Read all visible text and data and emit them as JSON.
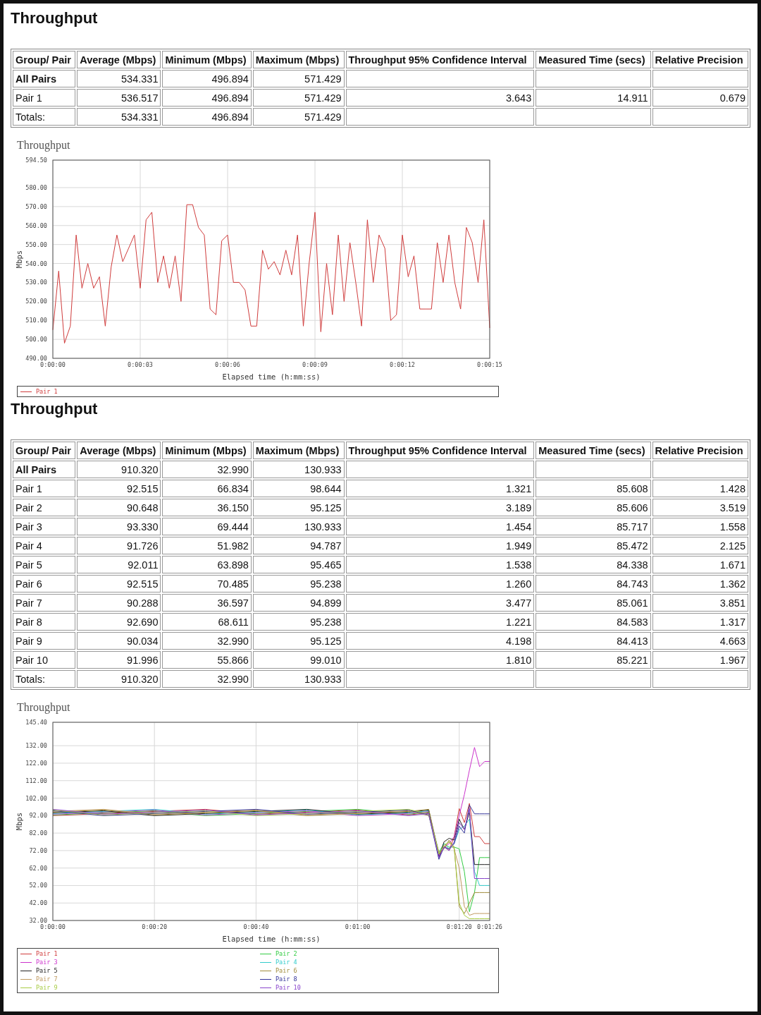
{
  "sections": [
    {
      "heading": "Throughput",
      "table": {
        "columns": [
          "Group/ Pair",
          "Average (Mbps)",
          "Minimum (Mbps)",
          "Maximum (Mbps)",
          "Throughput 95% Confidence Interval",
          "Measured Time (secs)",
          "Relative Precision"
        ],
        "rows": [
          {
            "kind": "group",
            "cells": [
              "All Pairs",
              "534.331",
              "496.894",
              "571.429",
              null,
              null,
              null
            ]
          },
          {
            "kind": "pair",
            "cells": [
              "Pair 1",
              "536.517",
              "496.894",
              "571.429",
              "3.643",
              "14.911",
              "0.679"
            ]
          },
          {
            "kind": "total",
            "cells": [
              "Totals:",
              "534.331",
              "496.894",
              "571.429",
              null,
              null,
              null
            ]
          }
        ]
      },
      "chart": {
        "chart_data": {
          "type": "line",
          "title": "Throughput",
          "xlabel": "Elapsed time (h:mm:ss)",
          "ylabel": "Mbps",
          "grid": true,
          "xlim": [
            0,
            15
          ],
          "ylim": [
            490,
            594.5
          ],
          "xticks": [
            {
              "value": 0,
              "label": "0:00:00"
            },
            {
              "value": 3,
              "label": "0:00:03"
            },
            {
              "value": 6,
              "label": "0:00:06"
            },
            {
              "value": 9,
              "label": "0:00:09"
            },
            {
              "value": 12,
              "label": "0:00:12"
            },
            {
              "value": 15,
              "label": "0:00:15"
            }
          ],
          "yticks": [
            {
              "value": 490,
              "label": "490.00"
            },
            {
              "value": 500,
              "label": "500.00"
            },
            {
              "value": 510,
              "label": "510.00"
            },
            {
              "value": 520,
              "label": "520.00"
            },
            {
              "value": 530,
              "label": "530.00"
            },
            {
              "value": 540,
              "label": "540.00"
            },
            {
              "value": 550,
              "label": "550.00"
            },
            {
              "value": 560,
              "label": "560.00"
            },
            {
              "value": 570,
              "label": "570.00"
            },
            {
              "value": 580,
              "label": "580.00"
            },
            {
              "value": 594.5,
              "label": "594.50"
            }
          ],
          "x": [
            0,
            0.2,
            0.4,
            0.6,
            0.8,
            1,
            1.2,
            1.4,
            1.6,
            1.8,
            2,
            2.2,
            2.4,
            2.6,
            2.8,
            3,
            3.2,
            3.4,
            3.6,
            3.8,
            4,
            4.2,
            4.4,
            4.6,
            4.8,
            5,
            5.2,
            5.4,
            5.6,
            5.8,
            6,
            6.2,
            6.4,
            6.6,
            6.8,
            7,
            7.2,
            7.4,
            7.6,
            7.8,
            8,
            8.2,
            8.4,
            8.6,
            8.8,
            9,
            9.2,
            9.4,
            9.6,
            9.8,
            10,
            10.2,
            10.4,
            10.6,
            10.8,
            11,
            11.2,
            11.4,
            11.6,
            11.8,
            12,
            12.2,
            12.4,
            12.6,
            12.8,
            13,
            13.2,
            13.4,
            13.6,
            13.8,
            14,
            14.2,
            14.4,
            14.6,
            14.8,
            15
          ],
          "series": [
            {
              "name": "Pair 1",
              "color": "#d03c3c",
              "values": [
                505,
                536,
                498,
                507,
                555,
                527,
                540,
                527,
                533,
                507,
                538,
                555,
                541,
                548,
                555,
                527,
                563,
                567,
                530,
                544,
                527,
                544,
                520,
                571,
                571,
                559,
                555,
                516,
                513,
                552,
                555,
                530,
                530,
                526,
                507,
                507,
                547,
                537,
                541,
                534,
                547,
                534,
                555,
                507,
                540,
                567,
                504,
                540,
                513,
                555,
                520,
                551,
                530,
                507,
                563,
                530,
                555,
                548,
                510,
                513,
                555,
                533,
                544,
                516,
                516,
                516,
                551,
                530,
                555,
                530,
                516,
                559,
                551,
                530,
                563,
                506
              ]
            }
          ]
        }
      }
    },
    {
      "heading": "Throughput",
      "table": {
        "columns": [
          "Group/ Pair",
          "Average (Mbps)",
          "Minimum (Mbps)",
          "Maximum (Mbps)",
          "Throughput 95% Confidence Interval",
          "Measured Time (secs)",
          "Relative Precision"
        ],
        "rows": [
          {
            "kind": "group",
            "cells": [
              "All Pairs",
              "910.320",
              "32.990",
              "130.933",
              null,
              null,
              null
            ]
          },
          {
            "kind": "pair",
            "cells": [
              "Pair 1",
              "92.515",
              "66.834",
              "98.644",
              "1.321",
              "85.608",
              "1.428"
            ]
          },
          {
            "kind": "pair",
            "cells": [
              "Pair 2",
              "90.648",
              "36.150",
              "95.125",
              "3.189",
              "85.606",
              "3.519"
            ]
          },
          {
            "kind": "pair",
            "cells": [
              "Pair 3",
              "93.330",
              "69.444",
              "130.933",
              "1.454",
              "85.717",
              "1.558"
            ]
          },
          {
            "kind": "pair",
            "cells": [
              "Pair 4",
              "91.726",
              "51.982",
              "94.787",
              "1.949",
              "85.472",
              "2.125"
            ]
          },
          {
            "kind": "pair",
            "cells": [
              "Pair 5",
              "92.011",
              "63.898",
              "95.465",
              "1.538",
              "84.338",
              "1.671"
            ]
          },
          {
            "kind": "pair",
            "cells": [
              "Pair 6",
              "92.515",
              "70.485",
              "95.238",
              "1.260",
              "84.743",
              "1.362"
            ]
          },
          {
            "kind": "pair",
            "cells": [
              "Pair 7",
              "90.288",
              "36.597",
              "94.899",
              "3.477",
              "85.061",
              "3.851"
            ]
          },
          {
            "kind": "pair",
            "cells": [
              "Pair 8",
              "92.690",
              "68.611",
              "95.238",
              "1.221",
              "84.583",
              "1.317"
            ]
          },
          {
            "kind": "pair",
            "cells": [
              "Pair 9",
              "90.034",
              "32.990",
              "95.125",
              "4.198",
              "84.413",
              "4.663"
            ]
          },
          {
            "kind": "pair",
            "cells": [
              "Pair 10",
              "91.996",
              "55.866",
              "99.010",
              "1.810",
              "85.221",
              "1.967"
            ]
          },
          {
            "kind": "total",
            "cells": [
              "Totals:",
              "910.320",
              "32.990",
              "130.933",
              null,
              null,
              null
            ]
          }
        ]
      },
      "chart": {
        "chart_data": {
          "type": "line",
          "title": "Throughput",
          "xlabel": "Elapsed time (h:mm:ss)",
          "ylabel": "Mbps",
          "grid": true,
          "xlim": [
            0,
            86
          ],
          "ylim": [
            32,
            145.4
          ],
          "xticks": [
            {
              "value": 0,
              "label": "0:00:00"
            },
            {
              "value": 20,
              "label": "0:00:20"
            },
            {
              "value": 40,
              "label": "0:00:40"
            },
            {
              "value": 60,
              "label": "0:01:00"
            },
            {
              "value": 80,
              "label": "0:01:20"
            },
            {
              "value": 86,
              "label": "0:01:26"
            }
          ],
          "yticks": [
            {
              "value": 32,
              "label": "32.00"
            },
            {
              "value": 42,
              "label": "42.00"
            },
            {
              "value": 52,
              "label": "52.00"
            },
            {
              "value": 62,
              "label": "62.00"
            },
            {
              "value": 72,
              "label": "72.00"
            },
            {
              "value": 82,
              "label": "82.00"
            },
            {
              "value": 92,
              "label": "92.00"
            },
            {
              "value": 102,
              "label": "102.00"
            },
            {
              "value": 112,
              "label": "112.00"
            },
            {
              "value": 122,
              "label": "122.00"
            },
            {
              "value": 132,
              "label": "132.00"
            },
            {
              "value": 145.4,
              "label": "145.40"
            }
          ],
          "x": [
            0,
            10,
            20,
            30,
            40,
            50,
            60,
            70,
            74,
            76,
            77,
            78,
            79,
            80,
            81,
            82,
            83,
            84,
            85,
            86
          ],
          "series": [
            {
              "name": "Pair 1",
              "color": "#d03c3c",
              "values": [
                92,
                93.2,
                94.4,
                95.6,
                92.8,
                94,
                95.2,
                92.4,
                93.6,
                70,
                75,
                72,
                80,
                96,
                88,
                99,
                80,
                80,
                76,
                76
              ]
            },
            {
              "name": "Pair 2",
              "color": "#33cc44",
              "values": [
                92.4,
                93.6,
                94.8,
                92,
                93.2,
                94.4,
                95.6,
                92.8,
                94,
                71,
                76,
                74,
                74,
                73,
                60,
                37,
                48,
                68,
                68,
                68
              ]
            },
            {
              "name": "Pair 3",
              "color": "#cc33cc",
              "values": [
                92.8,
                94,
                95.2,
                92.4,
                93.6,
                94.8,
                92,
                93.2,
                94.4,
                69,
                74,
                76,
                80,
                92,
                104,
                118,
                131,
                120,
                123,
                123
              ]
            },
            {
              "name": "Pair 4",
              "color": "#33cccc",
              "values": [
                93.2,
                94.4,
                95.6,
                92.8,
                94,
                95.2,
                92.4,
                93.6,
                94.8,
                70,
                76,
                73,
                76,
                84,
                86,
                90,
                60,
                52,
                52,
                52
              ]
            },
            {
              "name": "Pair 5",
              "color": "#222222",
              "values": [
                93.6,
                94.8,
                92,
                93.2,
                94.4,
                95.6,
                92.8,
                94,
                95.2,
                68,
                77,
                79,
                78,
                90,
                84,
                94,
                64,
                64,
                64,
                64
              ]
            },
            {
              "name": "Pair 6",
              "color": "#a08c3c",
              "values": [
                94,
                95.2,
                92.4,
                93.6,
                94.8,
                92,
                93.2,
                94.4,
                95.6,
                70,
                73,
                78,
                74,
                40,
                36,
                42,
                48,
                48,
                48,
                48
              ]
            },
            {
              "name": "Pair 7",
              "color": "#c09a60",
              "values": [
                94.4,
                95.6,
                92.8,
                94,
                95.2,
                92.4,
                93.6,
                94.8,
                92,
                71,
                74,
                77,
                73,
                62,
                40,
                35,
                36,
                36,
                36,
                36
              ]
            },
            {
              "name": "Pair 8",
              "color": "#333399",
              "values": [
                94.8,
                92,
                93.2,
                94.4,
                95.6,
                92.8,
                94,
                95.2,
                92.4,
                67,
                74,
                73,
                76,
                86,
                82,
                98,
                93,
                93,
                93,
                93
              ]
            },
            {
              "name": "Pair 9",
              "color": "#a8cc44",
              "values": [
                95.2,
                92.4,
                93.6,
                94.8,
                92,
                93.2,
                94.4,
                95.6,
                92.8,
                70,
                75,
                77,
                74,
                42,
                35,
                33,
                33,
                33,
                33,
                33
              ]
            },
            {
              "name": "Pair 10",
              "color": "#8844cc",
              "values": [
                95.6,
                92.8,
                94,
                95.2,
                92.4,
                93.6,
                94.8,
                92,
                93.2,
                68,
                74,
                72,
                77,
                88,
                84,
                96,
                56,
                56,
                56,
                56
              ]
            }
          ]
        }
      }
    }
  ]
}
